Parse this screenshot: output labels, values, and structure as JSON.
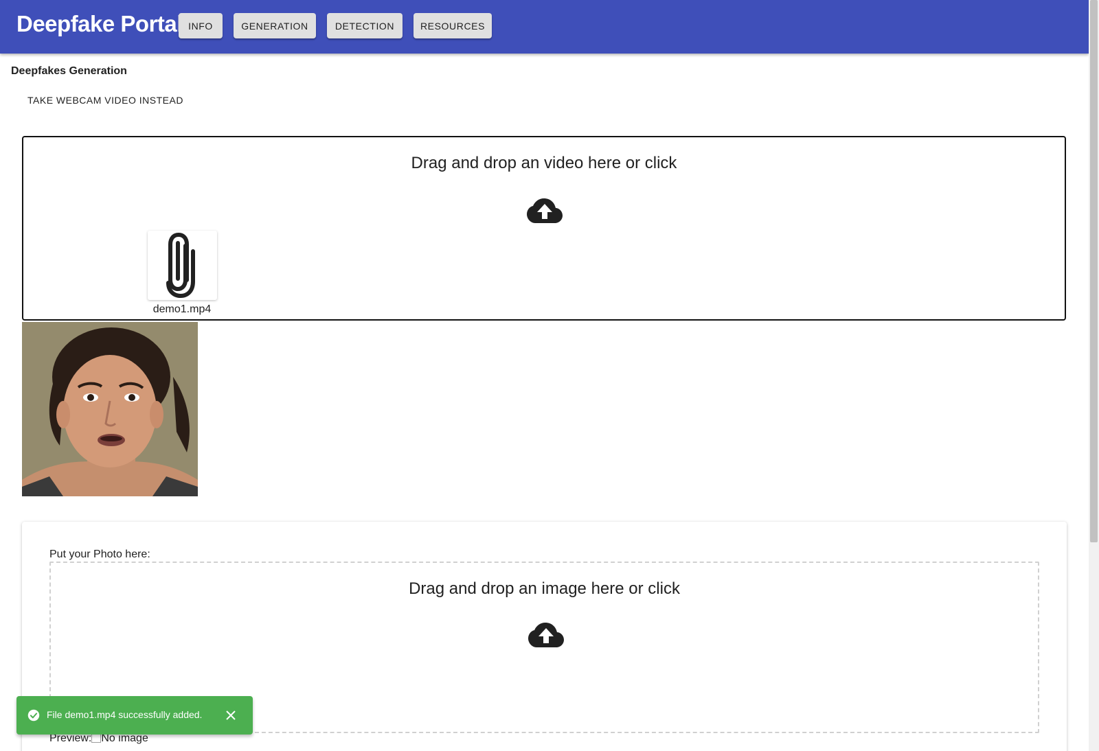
{
  "app": {
    "title": "Deepfake Portal"
  },
  "nav": {
    "items": [
      {
        "label": "INFO"
      },
      {
        "label": "GENERATION"
      },
      {
        "label": "DETECTION"
      },
      {
        "label": "RESOURCES"
      }
    ]
  },
  "main": {
    "section_title": "Deepfakes Generation",
    "webcam_button": "TAKE WEBCAM VIDEO INSTEAD",
    "video_dropzone": {
      "text": "Drag and drop an video here or click",
      "icon": "cloud-upload-icon",
      "file": {
        "name": "demo1.mp4",
        "icon": "paperclip-icon"
      }
    },
    "photo_card": {
      "label": "Put your Photo here:",
      "dropzone_text": "Drag and drop an image here or click",
      "icon": "cloud-upload-icon",
      "preview_label": "Preview:",
      "preview_alt": "No image"
    }
  },
  "snackbar": {
    "message": "File demo1.mp4 successfully added.",
    "icon": "check-circle-icon",
    "close_icon": "close-icon",
    "color": "#4caf50"
  },
  "colors": {
    "appbar": "#3f4fb9",
    "button": "#e0e0e0"
  }
}
